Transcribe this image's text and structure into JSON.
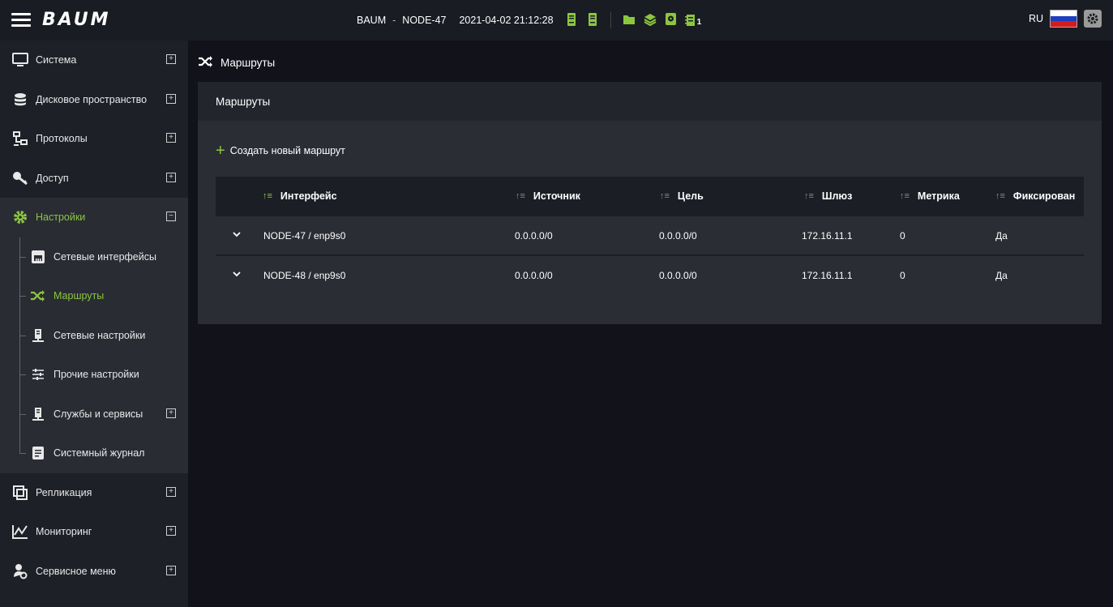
{
  "topbar": {
    "logo": "BAUM",
    "system": "BAUM",
    "separator": "-",
    "node": "NODE-47",
    "datetime": "2021-04-02 21:12:28",
    "disk_subscript": "1",
    "language": "RU",
    "accent_color": "#8cc63f"
  },
  "sidebar": {
    "items": [
      {
        "label": "Система",
        "icon": "monitor-icon"
      },
      {
        "label": "Дисковое пространство",
        "icon": "database-icon"
      },
      {
        "label": "Протоколы",
        "icon": "network-icon"
      },
      {
        "label": "Доступ",
        "icon": "key-icon"
      },
      {
        "label": "Настройки",
        "icon": "gear-icon"
      },
      {
        "label": "Репликация",
        "icon": "replication-icon"
      },
      {
        "label": "Мониторинг",
        "icon": "chart-icon"
      },
      {
        "label": "Сервисное меню",
        "icon": "user-gear-icon"
      }
    ],
    "settings_sub": [
      {
        "label": "Сетевые интерфейсы",
        "icon": "ethernet-icon"
      },
      {
        "label": "Маршруты",
        "icon": "shuffle-icon"
      },
      {
        "label": "Сетевые настройки",
        "icon": "server-icon"
      },
      {
        "label": "Прочие настройки",
        "icon": "sliders-icon"
      },
      {
        "label": "Службы и сервисы",
        "icon": "server-icon"
      },
      {
        "label": "Системный журнал",
        "icon": "journal-icon"
      }
    ]
  },
  "breadcrumb": {
    "label": "Маршруты"
  },
  "panel": {
    "title": "Маршруты",
    "create_label": "Создать новый маршрут",
    "columns": [
      "Интерфейс",
      "Источник",
      "Цель",
      "Шлюз",
      "Метрика",
      "Фиксирован"
    ],
    "rows": [
      [
        "NODE-47 / enp9s0",
        "0.0.0.0/0",
        "0.0.0.0/0",
        "172.16.11.1",
        "0",
        "Да"
      ],
      [
        "NODE-48 / enp9s0",
        "0.0.0.0/0",
        "0.0.0.0/0",
        "172.16.11.1",
        "0",
        "Да"
      ]
    ]
  }
}
